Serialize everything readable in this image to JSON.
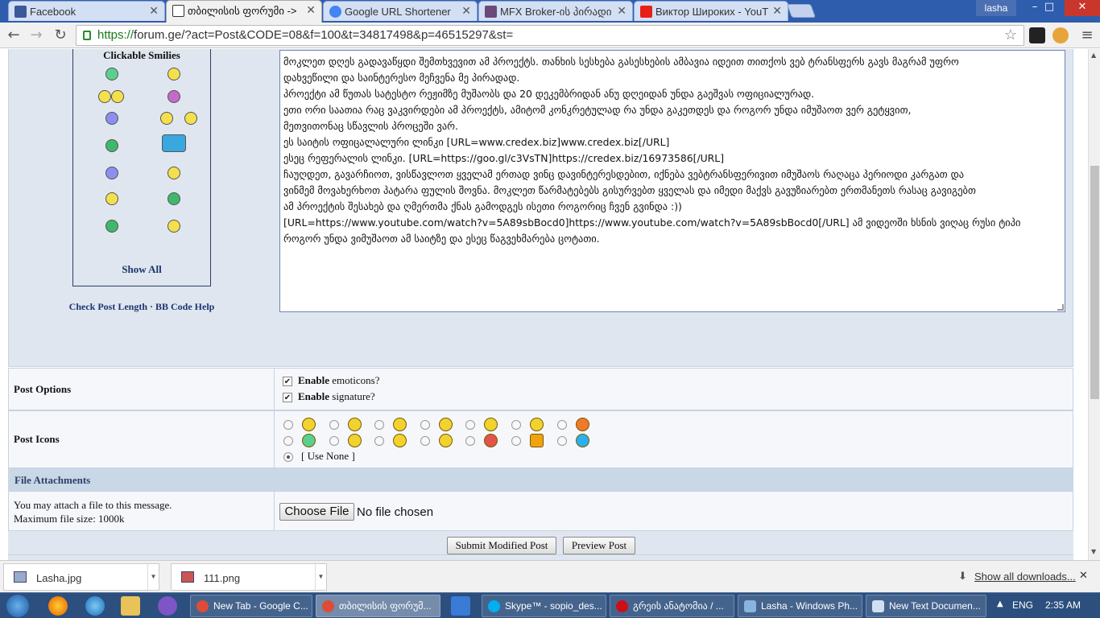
{
  "tabs": [
    {
      "title": "Facebook",
      "color": "#3b5998"
    },
    {
      "title": "თბილისის ფორუმი -> ",
      "color": "#333"
    },
    {
      "title": "Google URL Shortener",
      "color": "#4285f4"
    },
    {
      "title": "MFX Broker-ის პირადი კ",
      "color": "#5a3a6a"
    },
    {
      "title": "Виктор Широких - YouTu",
      "color": "#e62117"
    }
  ],
  "window": {
    "user": "lasha",
    "minimize": "–",
    "maximize": "□",
    "close": "✕"
  },
  "toolbar": {
    "back": "←",
    "forward": "→",
    "reload": "↻",
    "url_scheme": "https://",
    "url_rest": "forum.ge/?act=Post&CODE=08&f=100&t=34817498&p=46515297&st=",
    "star": "☆",
    "menu": "≡"
  },
  "smilies": {
    "title": "Clickable Smilies",
    "show_all": "Show All"
  },
  "editor_links": "Check Post Length · BB Code Help",
  "post_text": [
    "მოკლეთ დღეს გადავაწყდი შემთხვევით ამ პროექტს. თანხის სესხება გასესხების ამბავია იდეით თითქოს ვებ ტრანსფერს გავს მაგრამ უფრო",
    "დახვეწილი და საინტერესო მეჩვენა მე პირადად.",
    "პროექტი ამ წუთას სატესტო რეჟიმზე მუშაობს და 20 დეკემბრიდან ანუ დღეიდან უნდა გაეშვას ოფიციალურად.",
    "ეთი ორი საათია რაც ვაკვირდები ამ პროექტს,  ამიტომ კონკრეტულად რა უნდა გაკეთდეს და როგორ უნდა იმუშაოთ ვერ გეტყვით,",
    "მეთვითონაც სწავლის პროცეში ვარ.",
    "ეს საიტის ოფიცალალური ლინკი [URL=www.credex.biz]www.credex.biz[/URL]",
    "ესეც რეფერალის ლინკი. [URL=https://goo.gl/c3VsTN]https://credex.biz/16973586[/URL]",
    "ჩაუღდეთ, გავარჩიოთ, ვისწავლოთ ყველამ ერთად ვინც დავინტერესდებით, იქნება ვებტრანსფერივით იმუშაოს რაღაცა პერიოდი კარგათ და",
    "ვინმემ მოვახერხოთ  პატარა ფულის შოვნა. მოკლეთ წარმატებებს გისურვებთ ყველას და იმედი მაქვს გავუზიარებთ ერთმანეთს რასაც გავიგებთ",
    "ამ პროექტის შესახებ და ღმერთმა ქნას გამოდგეს ისეთი როგორიც ჩვენ გვინდა :))",
    "[URL=https://www.youtube.com/watch?v=5A89sbBocd0]https://www.youtube.com/watch?v=5A89sbBocd0[/URL] ამ ვიდეოში ხსნის ვიღაც რუსი ტიპი",
    "როგორ უნდა ვიმუშაოთ ამ საიტზე და ესეც წაგვეხმარება ცოტათი."
  ],
  "post_options": {
    "label": "Post Options",
    "emoticons_bold": "Enable",
    "emoticons_rest": " emoticons?",
    "signature_bold": "Enable",
    "signature_rest": " signature?",
    "emoticons_checked": true,
    "signature_checked": true
  },
  "post_icons": {
    "label": "Post Icons",
    "use_none": "[ Use None ]"
  },
  "file_attachments": {
    "header": "File Attachments",
    "line1": "You may attach a file to this message.",
    "line2": "Maximum file size: 1000k",
    "choose": "Choose File",
    "no_file": "No file chosen"
  },
  "buttons": {
    "submit": "Submit Modified Post",
    "preview": "Preview Post"
  },
  "downloads": {
    "items": [
      "Lasha.jpg",
      "111.png"
    ],
    "show_all": "Show all downloads...",
    "close": "✕"
  },
  "taskbar": {
    "items": [
      "New Tab - Google C...",
      "თბილისის ფორუმ...",
      "Skype™ - sopio_des...",
      "გრეის ანატომია / ...",
      "Lasha - Windows Ph...",
      "New Text Documen..."
    ],
    "lang": "ENG",
    "time": "2:35 AM"
  }
}
